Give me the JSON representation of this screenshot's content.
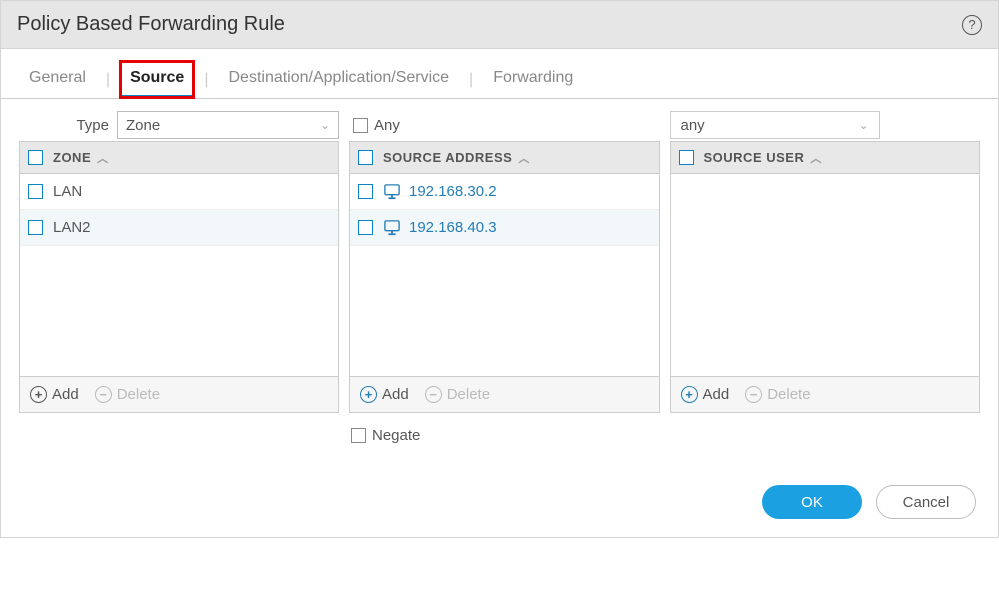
{
  "title": "Policy Based Forwarding Rule",
  "tabs": {
    "general": "General",
    "source": "Source",
    "dest": "Destination/Application/Service",
    "forwarding": "Forwarding"
  },
  "type": {
    "label": "Type",
    "value": "Zone"
  },
  "zone": {
    "header": "ZONE",
    "rows": [
      "LAN",
      "LAN2"
    ],
    "add": "Add",
    "delete": "Delete"
  },
  "address": {
    "any_label": "Any",
    "header": "SOURCE ADDRESS",
    "rows": [
      "192.168.30.2",
      "192.168.40.3"
    ],
    "add": "Add",
    "delete": "Delete",
    "negate": "Negate"
  },
  "user": {
    "selected": "any",
    "header": "SOURCE USER",
    "add": "Add",
    "delete": "Delete"
  },
  "buttons": {
    "ok": "OK",
    "cancel": "Cancel"
  }
}
